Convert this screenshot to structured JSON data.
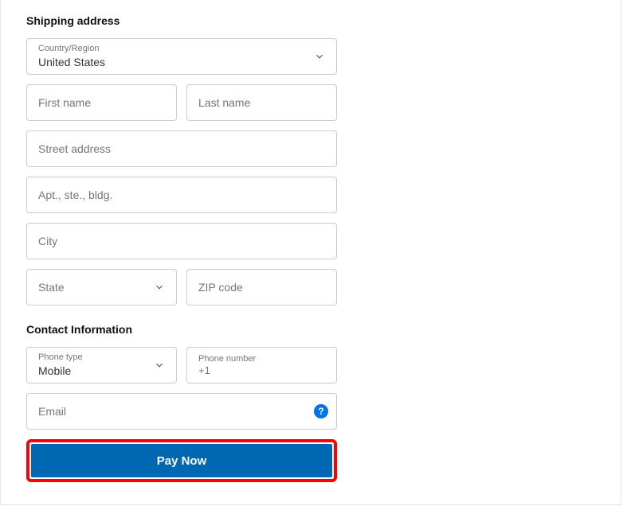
{
  "shipping": {
    "title": "Shipping address",
    "country_label": "Country/Region",
    "country_value": "United States",
    "first_name_placeholder": "First name",
    "last_name_placeholder": "Last name",
    "street_placeholder": "Street address",
    "apt_placeholder": "Apt., ste., bldg.",
    "city_placeholder": "City",
    "state_placeholder": "State",
    "zip_placeholder": "ZIP code"
  },
  "contact": {
    "title": "Contact Information",
    "phone_type_label": "Phone type",
    "phone_type_value": "Mobile",
    "phone_number_label": "Phone number",
    "phone_number_prefix": "+1",
    "email_placeholder": "Email",
    "help_symbol": "?"
  },
  "action": {
    "pay_label": "Pay Now"
  }
}
